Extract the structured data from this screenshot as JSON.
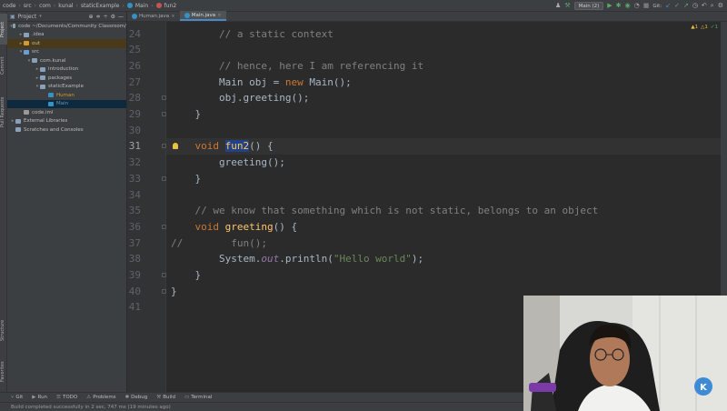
{
  "breadcrumb": [
    "code",
    "src",
    "com",
    "kunal",
    "staticExample",
    "Main",
    "fun2"
  ],
  "run_config": "Main (2)",
  "git_label": "Git:",
  "project_panel": {
    "title": "Project",
    "tree": [
      {
        "label": "code  ~/Documents/Community Classroom/",
        "indent": 0,
        "arrow": "▾",
        "color": "#8aa0b8"
      },
      {
        "label": ".idea",
        "indent": 1,
        "arrow": "▸",
        "color": "#8aa0b8"
      },
      {
        "label": "out",
        "indent": 1,
        "arrow": "▸",
        "color": "#d19a3a",
        "state": "excluded"
      },
      {
        "label": "src",
        "indent": 1,
        "arrow": "▾",
        "color": "#6a9fd4"
      },
      {
        "label": "com.kunal",
        "indent": 2,
        "arrow": "▾",
        "color": "#8aa0b8"
      },
      {
        "label": "introduction",
        "indent": 3,
        "arrow": "▸",
        "color": "#8aa0b8"
      },
      {
        "label": "packages",
        "indent": 3,
        "arrow": "▸",
        "color": "#8aa0b8"
      },
      {
        "label": "staticExample",
        "indent": 3,
        "arrow": "▾",
        "color": "#8aa0b8"
      },
      {
        "label": "Human",
        "indent": 4,
        "arrow": "",
        "color": "#3592c4",
        "text_color": "#d19a3a"
      },
      {
        "label": "Main",
        "indent": 4,
        "arrow": "",
        "color": "#3592c4",
        "text_color": "#6897bb",
        "state": "selected"
      },
      {
        "label": "code.iml",
        "indent": 1,
        "arrow": "",
        "color": "#999999"
      },
      {
        "label": "External Libraries",
        "indent": 0,
        "arrow": "▸",
        "color": "#8aa0b8"
      },
      {
        "label": "Scratches and Consoles",
        "indent": 0,
        "arrow": "",
        "color": "#8aa0b8"
      }
    ]
  },
  "left_tabs": {
    "project": "Project",
    "commit": "Commit",
    "pull_requests": "Pull Requests",
    "structure": "Structure",
    "favorites": "Favorites"
  },
  "editor_tabs": [
    {
      "label": "Human.java",
      "active": false
    },
    {
      "label": "Main.java",
      "active": true
    }
  ],
  "inspections": {
    "warnings": "▲1",
    "info": "△1",
    "typos": "✓1"
  },
  "code_lines": [
    {
      "num": "24",
      "html": "        <span class='cm'>// a static context</span>"
    },
    {
      "num": "25",
      "html": ""
    },
    {
      "num": "26",
      "html": "        <span class='cm'>// hence, here I am referencing it</span>"
    },
    {
      "num": "27",
      "html": "        Main obj = <span class='kw'>new</span> Main();"
    },
    {
      "num": "28",
      "html": "        obj.greeting();"
    },
    {
      "num": "29",
      "html": "    }"
    },
    {
      "num": "30",
      "html": ""
    },
    {
      "num": "31",
      "html": "    <span class='kw'>void</span> <span class='sel'>fun2</span>() {",
      "current": true
    },
    {
      "num": "32",
      "html": "        greeting();"
    },
    {
      "num": "33",
      "html": "    }"
    },
    {
      "num": "34",
      "html": ""
    },
    {
      "num": "35",
      "html": "    <span class='cm'>// we know that something which is not static, belongs to an object</span>"
    },
    {
      "num": "36",
      "html": "    <span class='kw'>void</span> <span class='fn'>greeting</span>() {"
    },
    {
      "num": "37",
      "html": "<span class='cm'>//        fun();</span>"
    },
    {
      "num": "38",
      "html": "        System.<span class='it'>out</span>.println(<span class='st'>\"Hello world\"</span>);"
    },
    {
      "num": "39",
      "html": "    }"
    },
    {
      "num": "40",
      "html": "}"
    },
    {
      "num": "41",
      "html": ""
    }
  ],
  "bottom_tools": [
    "Git",
    "Run",
    "TODO",
    "Problems",
    "Debug",
    "Build",
    "Terminal"
  ],
  "status_text": "Build completed successfully in 2 sec, 747 ms (19 minutes ago)",
  "colors": {
    "accent": "#4a88c7",
    "keyword": "#cc7832",
    "function": "#ffc66d",
    "comment": "#808080",
    "string": "#6a8759"
  }
}
